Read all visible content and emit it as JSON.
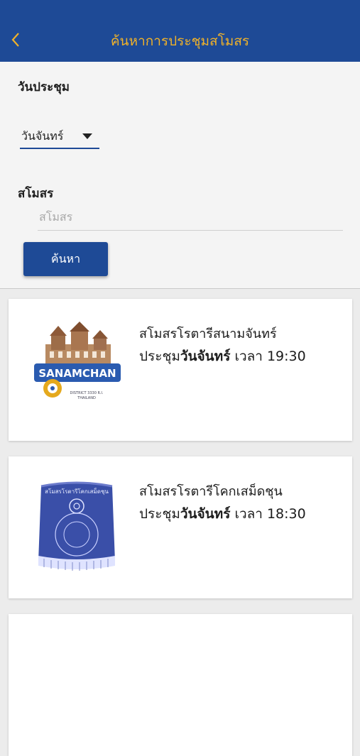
{
  "header": {
    "title": "ค้นหาการประชุมสโมสร"
  },
  "form": {
    "day_label": "วันประชุม",
    "day_selected": "วันจันทร์",
    "club_label": "สโมสร",
    "club_placeholder": "สโมสร",
    "club_value": "",
    "search_button": "ค้นหา"
  },
  "clubs": [
    {
      "name": "สโมสรโรตารีสนามจันทร์",
      "time_prefix": "ประชุม",
      "day": "วันจันทร์",
      "time_suffix": " เวลา 19:30",
      "logo_text": "SANAMCHAN",
      "logo_subtext_1": "DISTRICT 3330 R.I.",
      "logo_subtext_2": "THAILAND"
    },
    {
      "name": "สโมสรโรตารีโคกเสม็ดชุน",
      "time_prefix": "ประชุม",
      "day": "วันจันทร์",
      "time_suffix": " เวลา 18:30",
      "logo_text": "สโมสรโรตารีโคกเสม็ดชุน"
    }
  ],
  "colors": {
    "primary": "#1e4a96",
    "title": "#f0b229"
  }
}
